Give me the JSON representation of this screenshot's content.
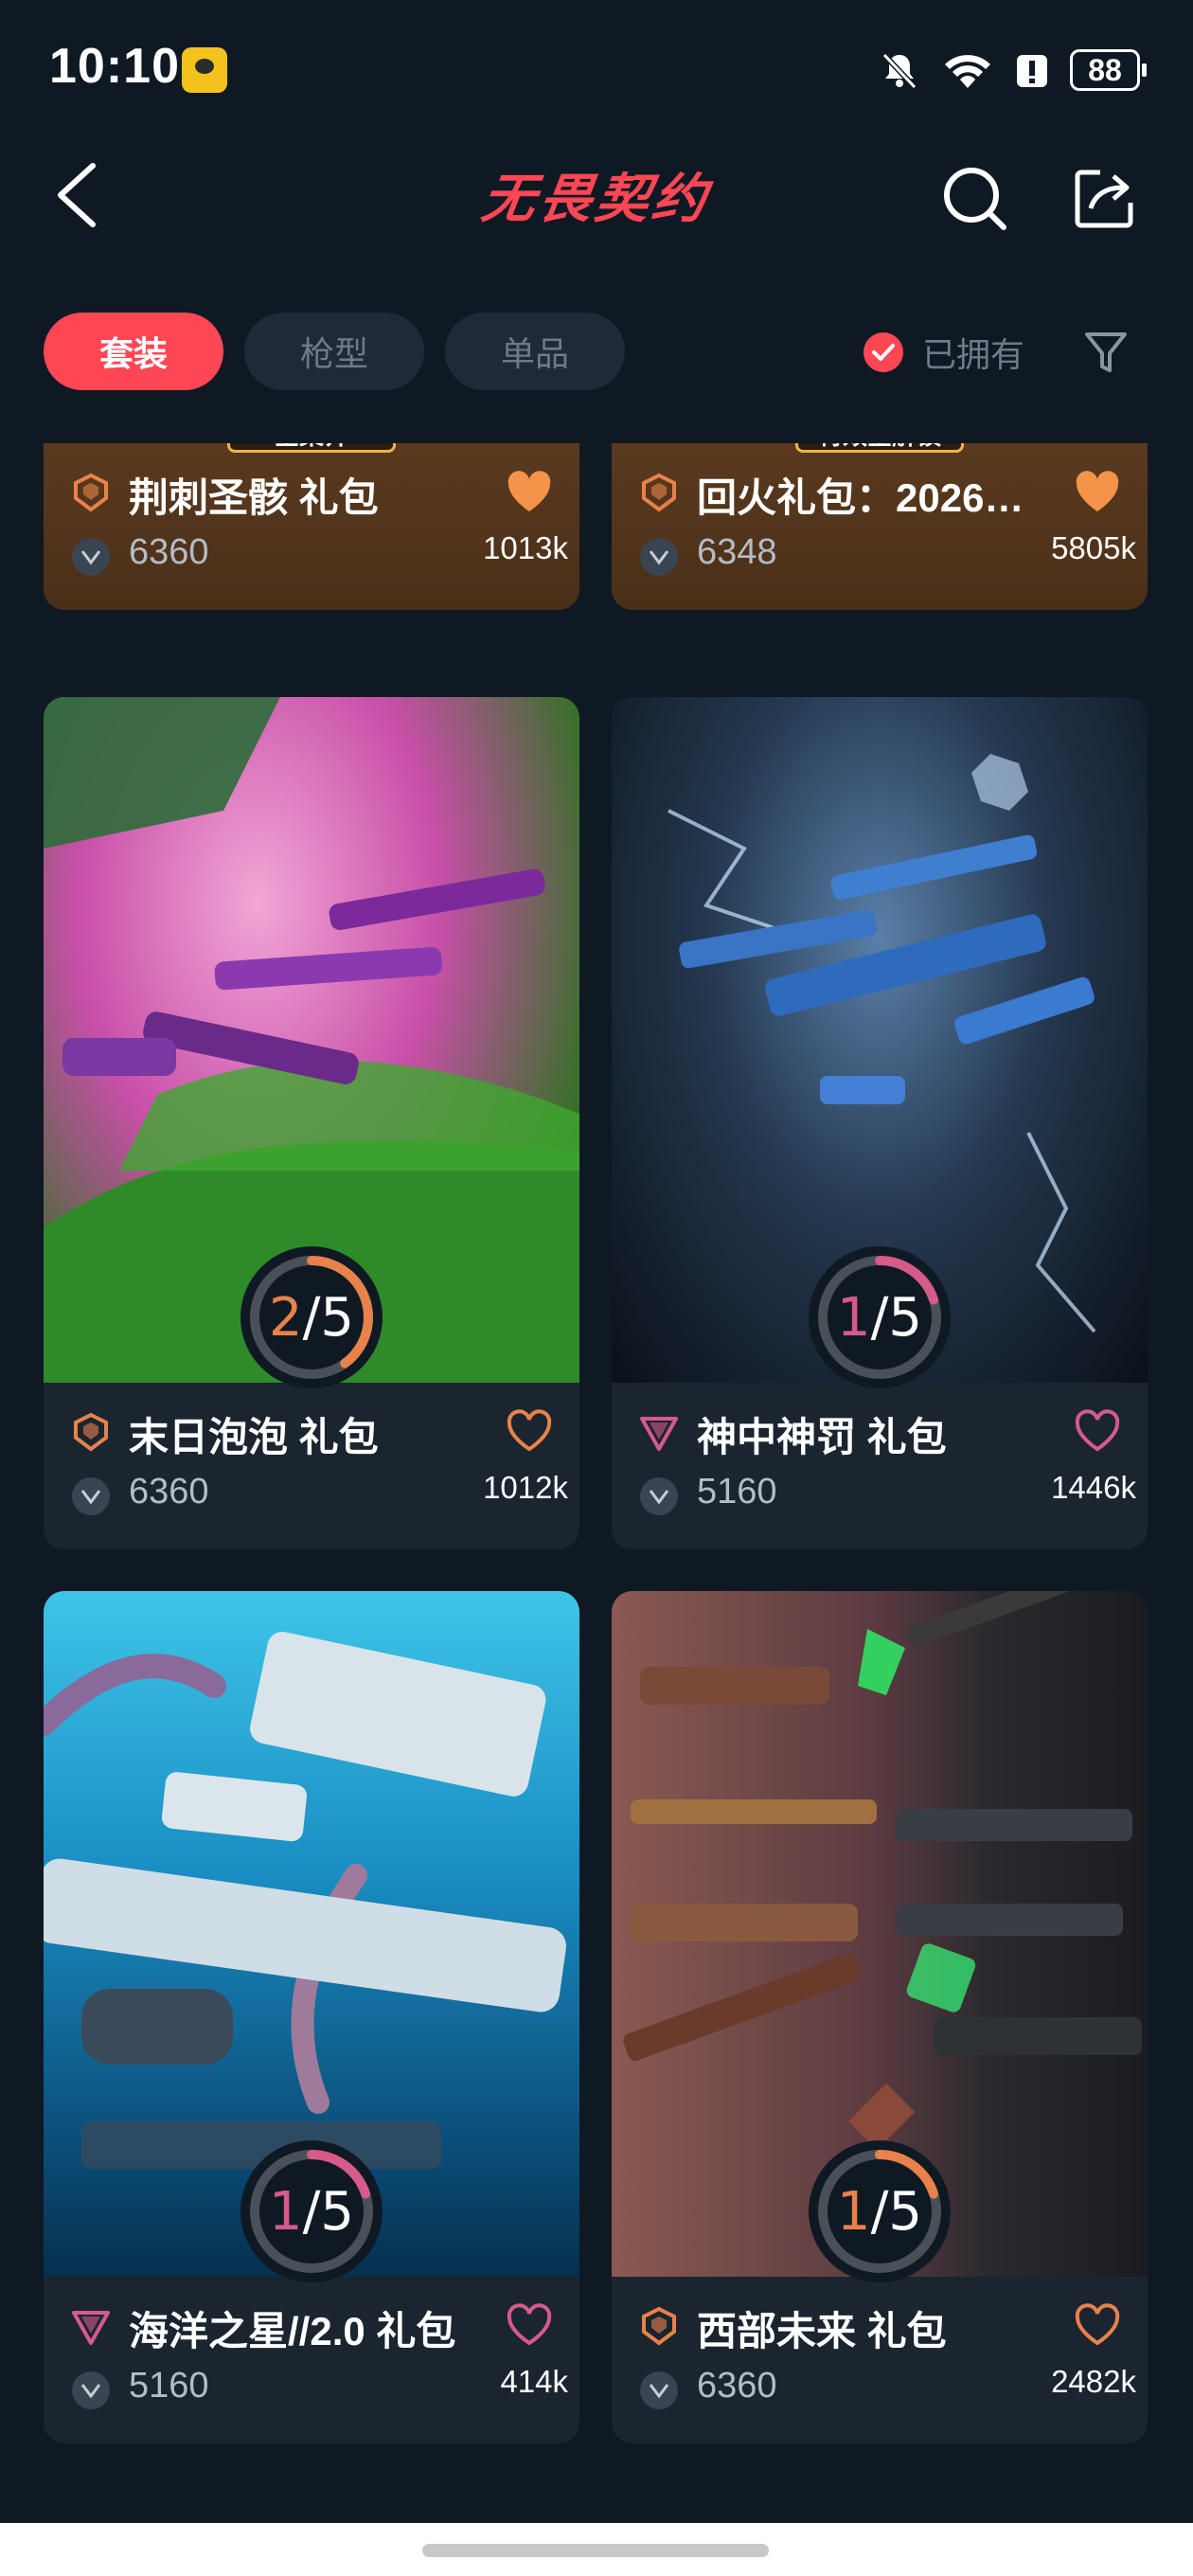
{
  "status_bar": {
    "time": "10:10",
    "battery": "88"
  },
  "header": {
    "title": "无畏契约"
  },
  "filters": {
    "tabs": [
      {
        "label": "套装",
        "active": true
      },
      {
        "label": "枪型",
        "active": false
      },
      {
        "label": "单品",
        "active": false
      }
    ],
    "owned_label": "已拥有"
  },
  "colors": {
    "accent": "#ff4655",
    "background": "#0f1923",
    "card": "#1a2530",
    "premium": "#e8824a",
    "exclusive": "#d65a8a"
  },
  "cards": [
    {
      "title": "荆刺圣骸 礼包",
      "price": "6360",
      "likes": "1013k",
      "tier": "premium",
      "heart": "filled",
      "banner": "全集齐"
    },
    {
      "title": "回火礼包：2026…",
      "price": "6348",
      "likes": "5805k",
      "tier": "premium",
      "heart": "filled",
      "banner": "特效全解锁"
    },
    {
      "title": "末日泡泡 礼包",
      "price": "6360",
      "likes": "1012k",
      "tier": "premium",
      "heart": "outline",
      "progress_num": "2",
      "progress_den": "/5",
      "progress": 0.4
    },
    {
      "title": "神中神罚 礼包",
      "price": "5160",
      "likes": "1446k",
      "tier": "exclusive",
      "heart": "outline",
      "progress_num": "1",
      "progress_den": "/5",
      "progress": 0.2
    },
    {
      "title": "海洋之星//2.0 礼包",
      "price": "5160",
      "likes": "414k",
      "tier": "exclusive",
      "heart": "outline",
      "progress_num": "1",
      "progress_den": "/5",
      "progress": 0.2
    },
    {
      "title": "西部未来 礼包",
      "price": "6360",
      "likes": "2482k",
      "tier": "premium",
      "heart": "outline",
      "progress_num": "1",
      "progress_den": "/5",
      "progress": 0.2
    }
  ],
  "icons": [
    "back-icon",
    "search-icon",
    "share-icon",
    "filter-icon",
    "check-icon",
    "heart-icon",
    "vp-currency-icon",
    "tier-icon",
    "mute-icon",
    "wifi-icon",
    "alert-icon"
  ]
}
